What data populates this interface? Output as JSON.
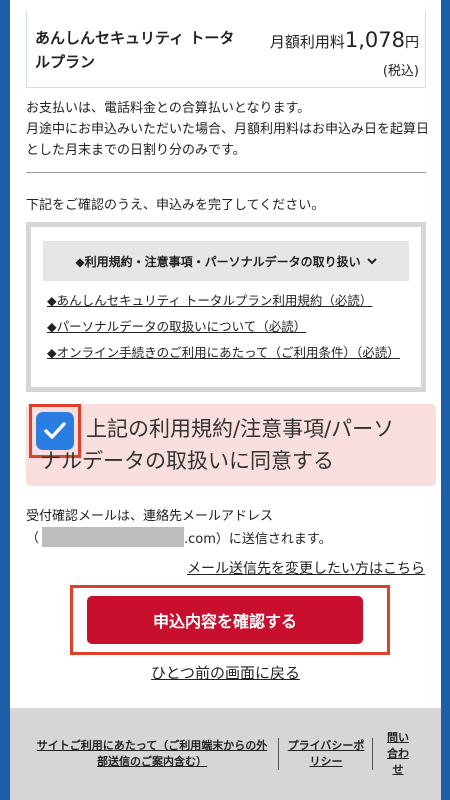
{
  "plan": {
    "name": "あんしんセキュリティ トータルプラン",
    "price_label": "月額利用料",
    "price_value": "1,078",
    "price_unit": "円",
    "tax_note": "(税込)"
  },
  "payment_note": "お支払いは、電話料金との合算払いとなります。\n月途中にお申込みいただいた場合、月額利用料はお申込み日を起算日とした月末までの日割り分のみです。",
  "instruction": "下記をご確認のうえ、申込みを完了してください。",
  "terms": {
    "header": "◆利用規約・注意事項・パーソナルデータの取り扱い",
    "chevron_icon": "chevron-down-icon",
    "links": [
      "◆あんしんセキュリティ トータルプラン利用規約（必読）",
      "◆パーソナルデータの取扱いについて（必読）",
      "◆オンライン手続きのご利用にあたって（ご利用条件）（必読）"
    ]
  },
  "agreement": {
    "checked": true,
    "line1": "上記の利用規約/注意事項/パーソ",
    "line2": "ナルデータの取扱いに同意する"
  },
  "mail": {
    "note_line1": "受付確認メールは、連絡先メールアドレス",
    "note_prefix": "（",
    "note_suffix": ".com）に送信されます。",
    "change_link": "メール送信先を変更したい方はこちら"
  },
  "actions": {
    "confirm_button": "申込内容を確認する",
    "back_link": "ひとつ前の画面に戻る"
  },
  "footer": {
    "site_usage": "サイトご利用にあたって（ご利用端末からの外部送信のご案内含む）",
    "privacy": "プライバシーポリシー",
    "contact": "問い合わせ"
  },
  "colors": {
    "primary_button": "#c8102e",
    "checkbox": "#2a7de1",
    "highlight_outline": "#e0402a",
    "agree_background": "#f9dede",
    "frame_border": "#1a5fa8"
  }
}
